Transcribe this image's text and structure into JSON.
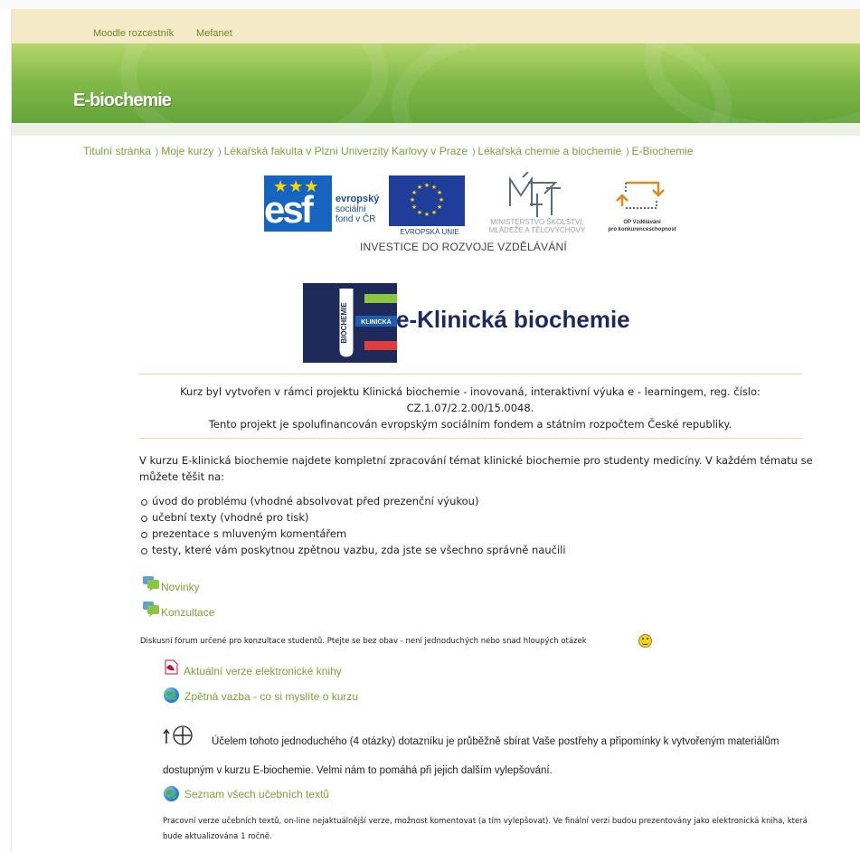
{
  "topnav": {
    "links": [
      "Moodle rozcestník",
      "Mefanet"
    ]
  },
  "banner": {
    "title": "E-biochemie"
  },
  "breadcrumb": {
    "separator": ")",
    "items": [
      "Titulní stránka",
      "Moje kurzy",
      "Lékařská fakulta v Plzni Univerzity Karlovy v Praze",
      "Lékařská chemie a biochemie",
      "E-Biochemie"
    ]
  },
  "logos": {
    "esf_letters": "esf",
    "esf_line1": "evropský",
    "esf_line2": "sociální",
    "esf_line3": "fond v ČR",
    "eu_label": "EVROPSKÁ UNIE",
    "msmt_line1": "MINISTERSTVO ŠKOLSTVÍ,",
    "msmt_line2": "MLÁDEŽE A TĚLOVÝCHOVY",
    "op_line1": "OP Vzdělávání",
    "op_line2": "pro konkurenceschopnost",
    "investice": "INVESTICE DO ROZVOJE VZDĚLÁVÁNÍ",
    "klin_vertical": "BIOCHEMIE",
    "klin_small": "KLINICKÁ",
    "klin_title": "e-Klinická biochemie"
  },
  "project": {
    "line1": "Kurz byl vytvořen v rámci projektu Klinická biochemie - inovovaná, interaktivní výuka e - learningem, reg. číslo:",
    "line2": "CZ.1.07/2.2.00/15.0048.",
    "line3": "Tento projekt je spolufinancován evropským sociálním fondem a státním rozpočtem České republiky."
  },
  "intro": {
    "text": "V kurzu E-klinická biochemie najdete kompletní zpracování témat klinické biochemie pro studenty medicíny. V každém tématu se můžete těšit na:",
    "bullets": [
      "úvod do problému (vhodné absolvovat před prezenční výukou)",
      "učební texty (vhodné pro tisk)",
      "prezentace s mluveným komentářem",
      "testy, které vám poskytnou zpětnou vazbu, zda jste se všechno správně naučili"
    ]
  },
  "forums": {
    "novinky": "Novinky",
    "konzultace": "Konzultace",
    "konzultace_desc": "Diskusní fórum určené pro konzultace studentů. Ptejte se bez obav - není jednoduchých nebo snad hloupých otázek"
  },
  "resources": {
    "ebook": "Aktuální verze elektronické knihy",
    "feedback": "Zpětná vazba - co si myslíte o kurzu",
    "feedback_desc": "Účelem tohoto jednoduchého (4 otázky) dotazníku je průběžně sbírat Vaše postřehy a připomínky k vytvořeným materiálům dostupným v kurzu E-biochemie. Velmi nám to pomáhá při jejich dalším vylepšování.",
    "texts": "Seznam všech učebních textů",
    "texts_desc": "Pracovní verze učebních textů, on-line nejaktuálnější verze, možnost komentovat (a tím vylepšovat). Ve finální verzi budou prezentovány jako elektronická kniha, která bude aktualizována 1 ročně."
  },
  "colors": {
    "link_green": "#7ba23a",
    "nav_bg": "#f4eac8",
    "banner_green": "#84bb4a"
  }
}
